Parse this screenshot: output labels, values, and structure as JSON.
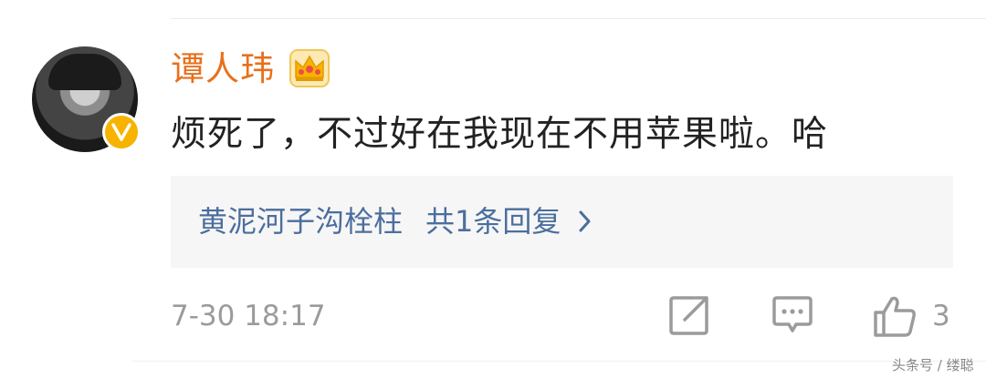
{
  "comment": {
    "username": "谭人玮",
    "text": "烦死了，不过好在我现在不用苹果啦。哈",
    "timestamp": "7-30 18:17"
  },
  "reply": {
    "author": "黄泥河子沟栓柱",
    "count_label": "共1条回复"
  },
  "actions": {
    "like_count": "3"
  },
  "watermark": "头条号 / 缕聪",
  "colors": {
    "username": "#e8701c",
    "reply_link": "#4b6e9e",
    "verified_badge": "#f6b400",
    "muted": "#9b9b9b"
  },
  "icons": [
    "verified-icon",
    "crown-icon",
    "chevron-right-icon",
    "share-icon",
    "comment-icon",
    "like-icon"
  ]
}
